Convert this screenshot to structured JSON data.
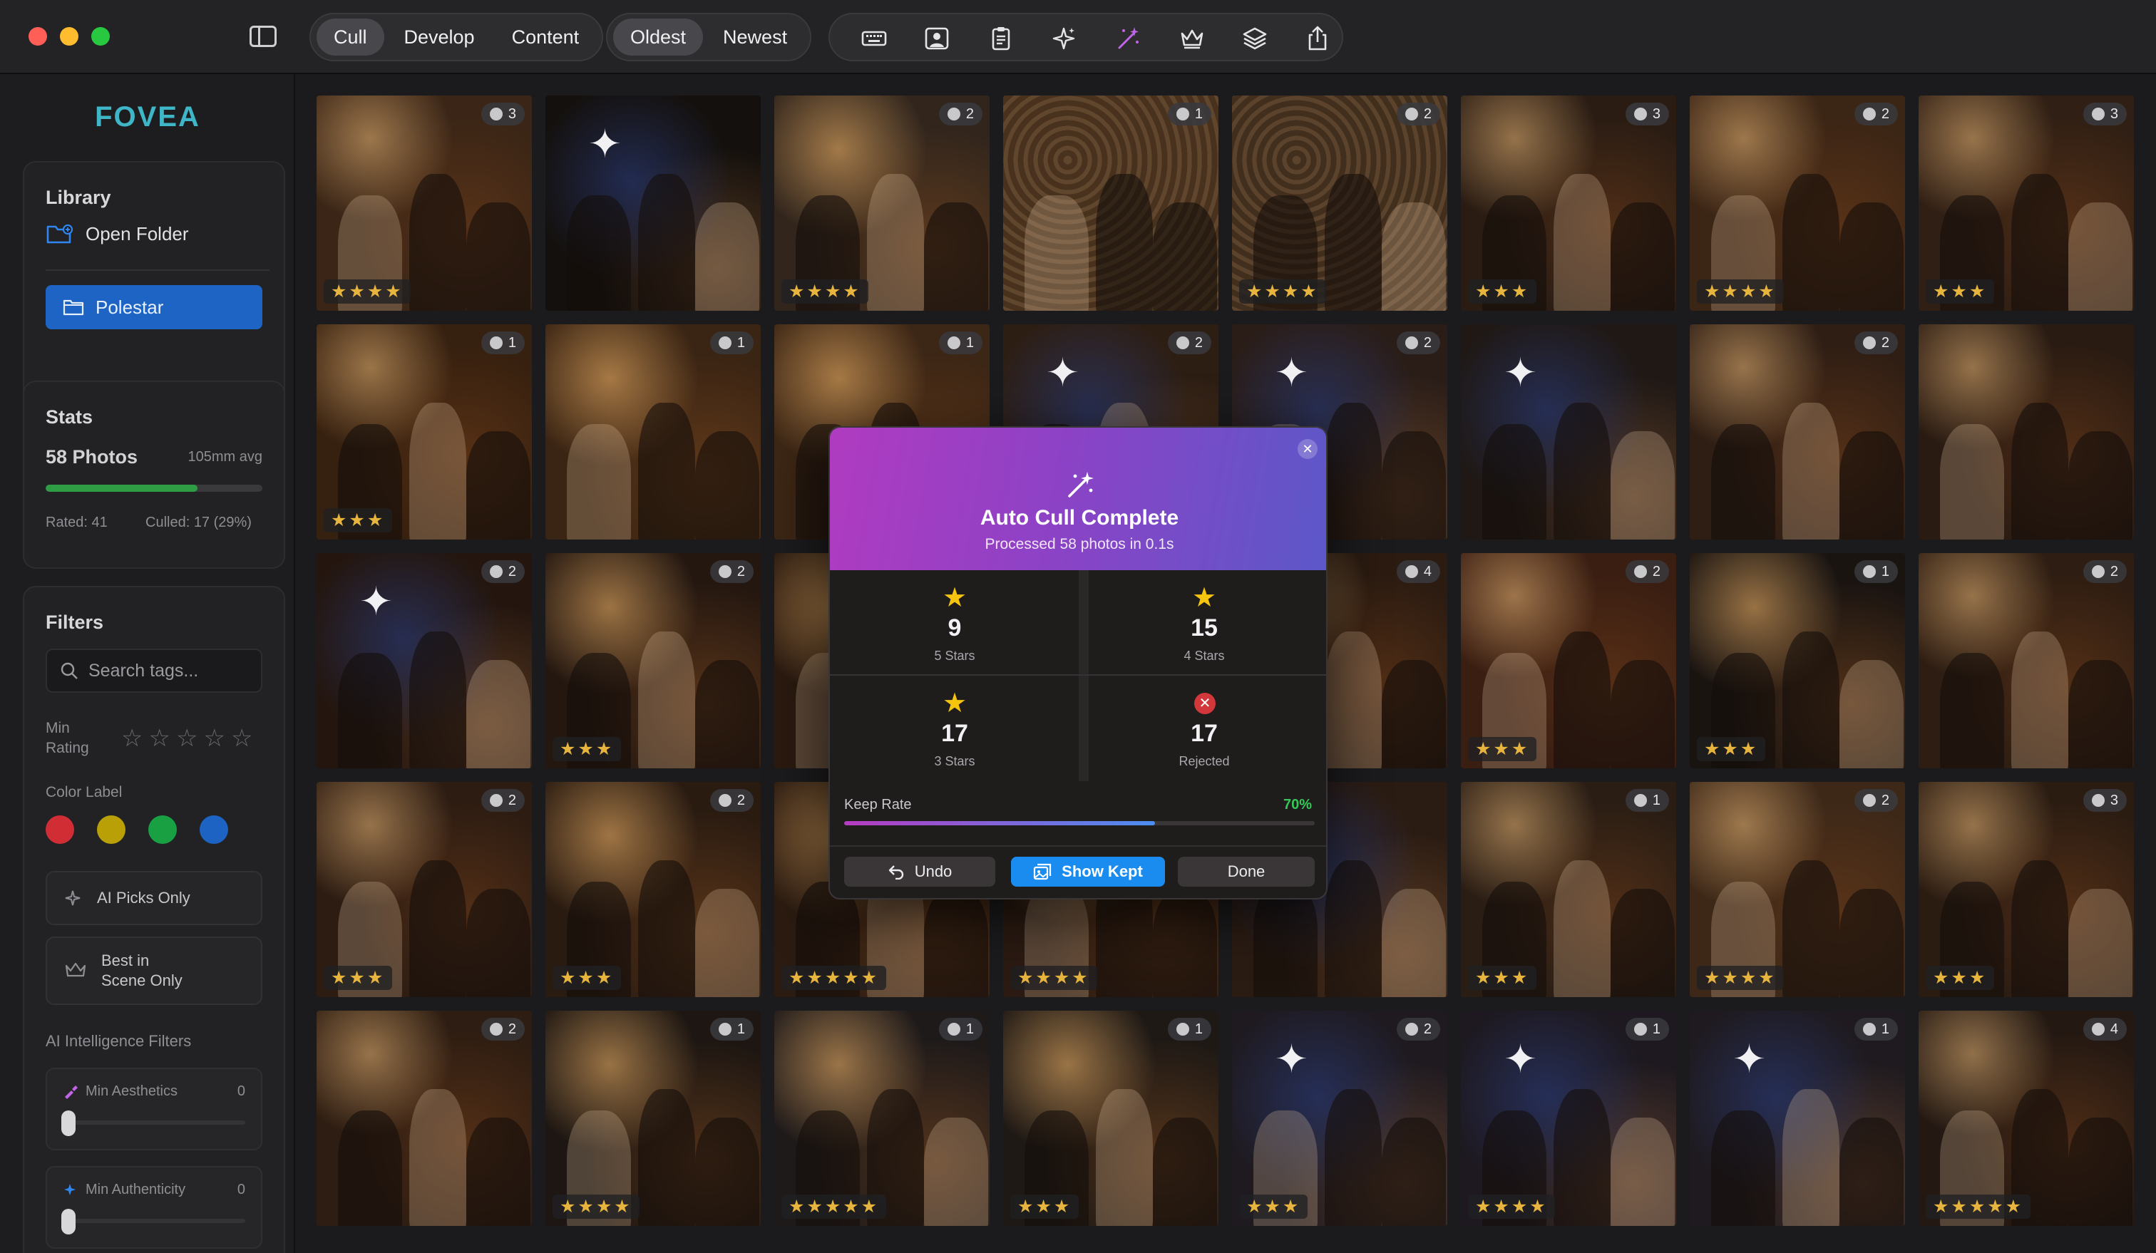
{
  "toolbar": {
    "modes": [
      "Cull",
      "Develop",
      "Content"
    ],
    "active_mode": "Cull",
    "sort": [
      "Oldest",
      "Newest"
    ],
    "active_sort": "Oldest"
  },
  "sidebar": {
    "logo": "FOVEA",
    "library": {
      "title": "Library",
      "open_folder": "Open Folder",
      "folder_name": "Polestar"
    },
    "stats": {
      "title": "Stats",
      "photos": "58 Photos",
      "avg": "105mm avg",
      "rated": "Rated: 41",
      "culled": "Culled: 17 (29%)",
      "progress_pct": 70
    },
    "filters": {
      "title": "Filters",
      "search_placeholder": "Search tags...",
      "min_rating_label": "Min\nRating",
      "color_label": "Color Label",
      "colors": [
        "#d02d35",
        "#b9a006",
        "#18a042",
        "#1d63c3"
      ],
      "ai_picks": "AI Picks Only",
      "best_in_scene": "Best in\nScene Only",
      "ai_section": "AI Intelligence Filters",
      "sliders": [
        {
          "label": "Min Aesthetics",
          "value": "0"
        },
        {
          "label": "Min Authenticity",
          "value": "0"
        }
      ]
    }
  },
  "grid": {
    "thumbs": [
      {
        "face": "3",
        "stars": "★★★★",
        "bg": "#3a2516",
        "variant": 1
      },
      {
        "face": "",
        "stars": "",
        "bg": "#14100d",
        "variant": 3,
        "flag": true
      },
      {
        "face": "2",
        "stars": "★★★★",
        "bg": "#31251c",
        "variant": 2
      },
      {
        "face": "1",
        "stars": "",
        "bg": "#4a321f",
        "variant": 4
      },
      {
        "face": "2",
        "stars": "★★★★",
        "bg": "#3e2b1b",
        "variant": 4
      },
      {
        "face": "3",
        "stars": "★★★",
        "bg": "#2a1c13",
        "variant": 1
      },
      {
        "face": "2",
        "stars": "★★★★",
        "bg": "#3b2515",
        "variant": 1
      },
      {
        "face": "3",
        "stars": "★★★",
        "bg": "#301f14",
        "variant": 1
      },
      {
        "face": "1",
        "stars": "★★★",
        "bg": "#36200f",
        "variant": 1
      },
      {
        "face": "1",
        "stars": "",
        "bg": "#3a2413",
        "variant": 2
      },
      {
        "face": "1",
        "stars": "",
        "bg": "#3c2615",
        "variant": 2
      },
      {
        "face": "2",
        "stars": "",
        "bg": "#2d1e14",
        "variant": 3
      },
      {
        "face": "2",
        "stars": "",
        "bg": "#2a1d18",
        "variant": 3
      },
      {
        "face": "",
        "stars": "",
        "bg": "#1f1815",
        "variant": 3,
        "flag": true
      },
      {
        "face": "2",
        "stars": "",
        "bg": "#2f1e14",
        "variant": 1
      },
      {
        "face": "",
        "stars": "",
        "bg": "#2a1b12",
        "variant": 1
      },
      {
        "face": "2",
        "stars": "",
        "bg": "#24160f",
        "variant": 3
      },
      {
        "face": "2",
        "stars": "★★★",
        "bg": "#241710",
        "variant": 2
      },
      {
        "face": "",
        "stars": "",
        "bg": "#2a1a10",
        "variant": 2
      },
      {
        "face": "",
        "stars": "",
        "bg": "#2a1a10",
        "variant": 2
      },
      {
        "face": "4",
        "stars": "",
        "bg": "#2b1b11",
        "variant": 1
      },
      {
        "face": "2",
        "stars": "★★★",
        "bg": "#3a1e12",
        "variant": 1
      },
      {
        "face": "1",
        "stars": "★★★",
        "bg": "#1a1411",
        "variant": 2
      },
      {
        "face": "2",
        "stars": "",
        "bg": "#2e1d12",
        "variant": 1
      },
      {
        "face": "2",
        "stars": "★★★",
        "bg": "#2d1c12",
        "variant": 1
      },
      {
        "face": "2",
        "stars": "★★★",
        "bg": "#2a1b11",
        "variant": 2
      },
      {
        "face": "",
        "stars": "★★★★★",
        "bg": "#2b1b11",
        "variant": 2
      },
      {
        "face": "",
        "stars": "★★★★",
        "bg": "#2a1a11",
        "variant": 2
      },
      {
        "face": "",
        "stars": "",
        "bg": "#2b1c13",
        "variant": 3
      },
      {
        "face": "1",
        "stars": "★★★",
        "bg": "#2a1d14",
        "variant": 1
      },
      {
        "face": "2",
        "stars": "★★★★",
        "bg": "#3d2818",
        "variant": 1
      },
      {
        "face": "3",
        "stars": "★★★",
        "bg": "#2b1c12",
        "variant": 1
      },
      {
        "face": "2",
        "stars": "",
        "bg": "#2e1d12",
        "variant": 1
      },
      {
        "face": "1",
        "stars": "★★★★",
        "bg": "#1d1612",
        "variant": 2
      },
      {
        "face": "1",
        "stars": "★★★★★",
        "bg": "#1f1a1a",
        "variant": 2
      },
      {
        "face": "1",
        "stars": "★★★",
        "bg": "#1f1915",
        "variant": 2
      },
      {
        "face": "2",
        "stars": "★★★",
        "bg": "#1f1a20",
        "variant": 3
      },
      {
        "face": "1",
        "stars": "★★★★",
        "bg": "#1e1920",
        "variant": 3
      },
      {
        "face": "1",
        "stars": "",
        "bg": "#1f1a1f",
        "variant": 3
      },
      {
        "face": "4",
        "stars": "★★★★★",
        "bg": "#231812",
        "variant": 1
      }
    ]
  },
  "modal": {
    "title": "Auto Cull Complete",
    "subtitle": "Processed 58 photos in 0.1s",
    "stats": [
      {
        "num": "9",
        "label": "5 Stars"
      },
      {
        "num": "15",
        "label": "4 Stars"
      },
      {
        "num": "17",
        "label": "3 Stars"
      },
      {
        "num": "17",
        "label": "Rejected"
      }
    ],
    "keep_rate_label": "Keep Rate",
    "keep_rate_value": "70%",
    "keep_rate_fraction": 0.66,
    "undo": "Undo",
    "show_kept": "Show Kept",
    "done": "Done",
    "close_glyph": "✕",
    "star_glyph": "★",
    "reject_glyph": "✕"
  }
}
